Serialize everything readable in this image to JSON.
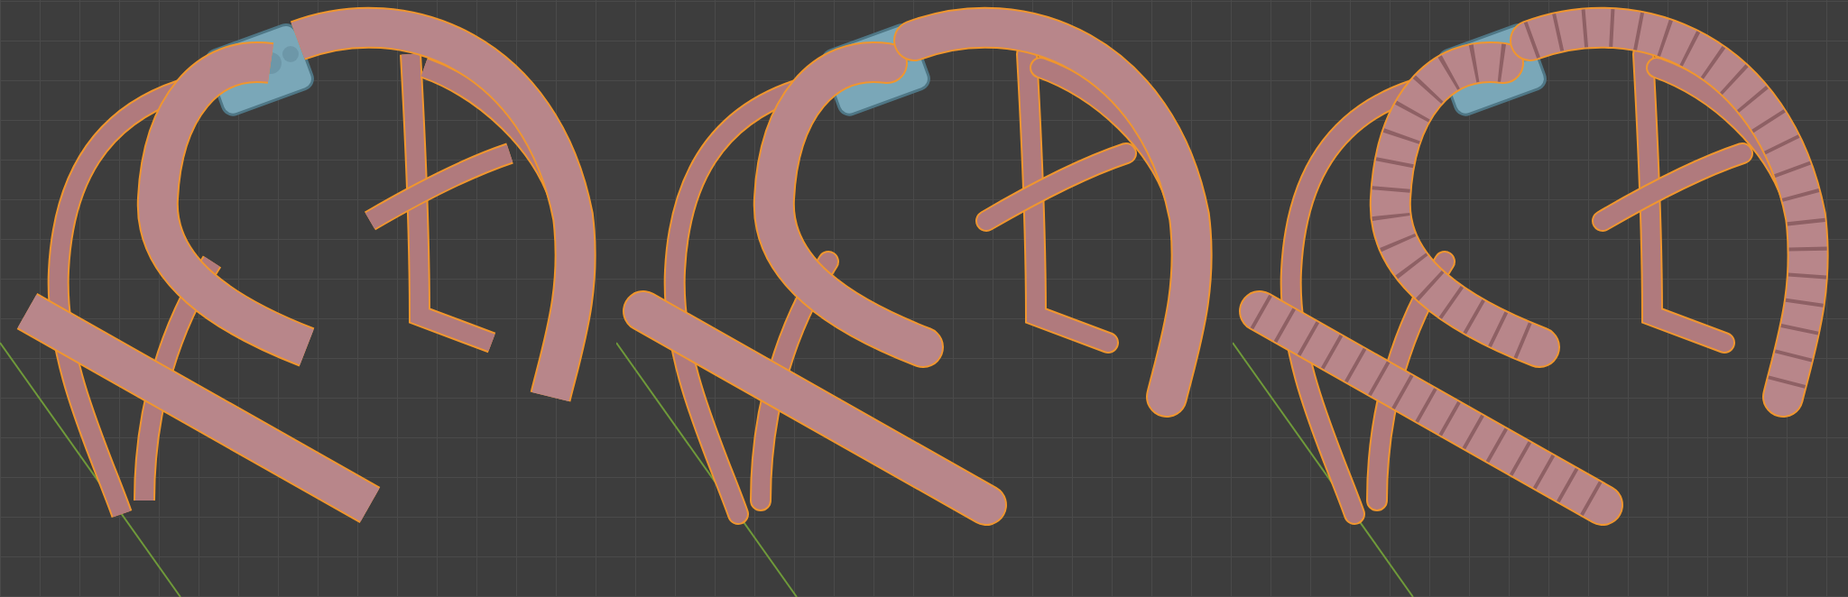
{
  "panels": [
    {
      "kind": "blockout",
      "selected": true
    },
    {
      "kind": "smooth",
      "selected": true
    },
    {
      "kind": "detailed",
      "selected": true
    }
  ]
}
